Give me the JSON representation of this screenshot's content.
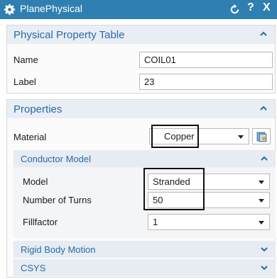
{
  "window": {
    "title": "PlanePhysical",
    "reset_icon": "reset-icon",
    "help_label": "?",
    "close_label": "X"
  },
  "physical_property_table": {
    "header": "Physical Property Table",
    "name_label": "Name",
    "name_value": "COIL01",
    "label_label": "Label",
    "label_value": "23"
  },
  "properties": {
    "header": "Properties",
    "material_label": "Material",
    "material_value": "Copper",
    "material_browse_icon": "material-library-icon"
  },
  "conductor_model": {
    "header": "Conductor Model",
    "model_label": "Model",
    "model_value": "Stranded",
    "turns_label": "Number of Turns",
    "turns_value": "50",
    "fillfactor_label": "Fillfactor",
    "fillfactor_value": "1"
  },
  "rigid_body_motion": {
    "header": "Rigid Body Motion"
  },
  "csys": {
    "header": "CSYS"
  },
  "colors": {
    "titlebar": "#2f7fb0",
    "section_text": "#2a6aa6",
    "section_bg": "#e9eef4"
  }
}
